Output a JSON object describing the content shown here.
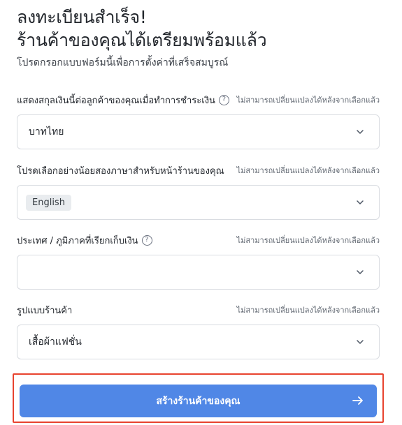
{
  "header": {
    "title_line1": "ลงทะเบียนสำเร็จ!",
    "title_line2": "ร้านค้าของคุณได้เตรียมพร้อมแล้ว",
    "subtitle": "โปรดกรอกแบบฟอร์มนี้เพื่อการตั้งค่าที่เสร็จสมบูรณ์"
  },
  "currency": {
    "label": "แสดงสกุลเงินนี้ต่อลูกค้าของคุณเมื่อทำการชำระเงิน",
    "note": "ไม่สามารถเปลี่ยนแปลงได้หลังจากเลือกแล้ว",
    "value": "บาทไทย"
  },
  "languages": {
    "label": "โปรดเลือกอย่างน้อยสองภาษาสำหรับหน้าร้านของคุณ",
    "note": "ไม่สามารถเปลี่ยนแปลงได้หลังจากเลือกแล้ว",
    "selected": [
      "English"
    ]
  },
  "region": {
    "label": "ประเทศ / ภูมิภาคที่เรียกเก็บเงิน",
    "note": "ไม่สามารถเปลี่ยนแปลงได้หลังจากเลือกแล้ว",
    "value": ""
  },
  "store_type": {
    "label": "รูปแบบร้านค้า",
    "note": "ไม่สามารถเปลี่ยนแปลงได้หลังจากเลือกแล้ว",
    "value": "เสื้อผ้าแฟชั่น"
  },
  "submit": {
    "label": "สร้างร้านค้าของคุณ"
  },
  "colors": {
    "primary": "#5087e6",
    "highlight": "#e8432f",
    "chip_bg": "#e9ecef"
  },
  "icons": {
    "help": "question-circle-icon",
    "dropdown": "chevron-down-icon",
    "submit": "arrow-right-icon"
  }
}
